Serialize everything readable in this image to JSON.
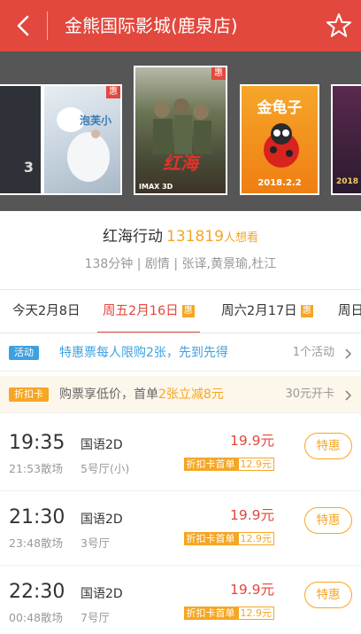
{
  "header": {
    "title": "金熊国际影城(鹿泉店)"
  },
  "posters": [
    {
      "text": "3",
      "bg": "#2e3238"
    },
    {
      "text": "泡芙小",
      "badge": "惠",
      "bg": "#cfd9e3"
    },
    {
      "text": "红海",
      "badge": "惠",
      "sub": "IMAX 3D",
      "bg": "#5a6247"
    },
    {
      "text": "金龟子",
      "sub": "2018.2.2",
      "bg": "#ef8a1a"
    },
    {
      "text": "2018",
      "bg": "#3a1f3a"
    }
  ],
  "movie": {
    "title": "红海行动",
    "wish_count": "131819",
    "wish_label": "人想看",
    "meta": "138分钟 | 剧情 | 张译,黄景瑜,杜江"
  },
  "dates": [
    {
      "label": "今天2月8日"
    },
    {
      "label": "周五2月16日",
      "badge": "惠",
      "active": true
    },
    {
      "label": "周六2月17日",
      "badge": "惠"
    },
    {
      "label": "周日"
    }
  ],
  "promos": {
    "activity": {
      "tag": "活动",
      "text": "特惠票每人限购2张，先到先得",
      "right": "1个活动"
    },
    "card": {
      "tag": "折扣卡",
      "text_pre": "购票享低价，首单",
      "text_highlight": "2张立减8元",
      "right": "30元开卡"
    }
  },
  "showtimes": [
    {
      "time": "19:35",
      "end": "21:53散场",
      "lang": "国语2D",
      "hall": "5号厅(小)",
      "price": "19.9元",
      "card_label": "折扣卡首单",
      "card_price": "12.9元",
      "button": "特惠"
    },
    {
      "time": "21:30",
      "end": "23:48散场",
      "lang": "国语2D",
      "hall": "3号厅",
      "price": "19.9元",
      "card_label": "折扣卡首单",
      "card_price": "12.9元",
      "button": "特惠"
    },
    {
      "time": "22:30",
      "end": "00:48散场",
      "lang": "国语2D",
      "hall": "7号厅",
      "price": "19.9元",
      "card_label": "折扣卡首单",
      "card_price": "12.9元",
      "button": "特惠"
    }
  ],
  "colors": {
    "brand_red": "#e2483d",
    "accent_orange": "#f5a623",
    "activity_blue": "#3fa0e0"
  }
}
